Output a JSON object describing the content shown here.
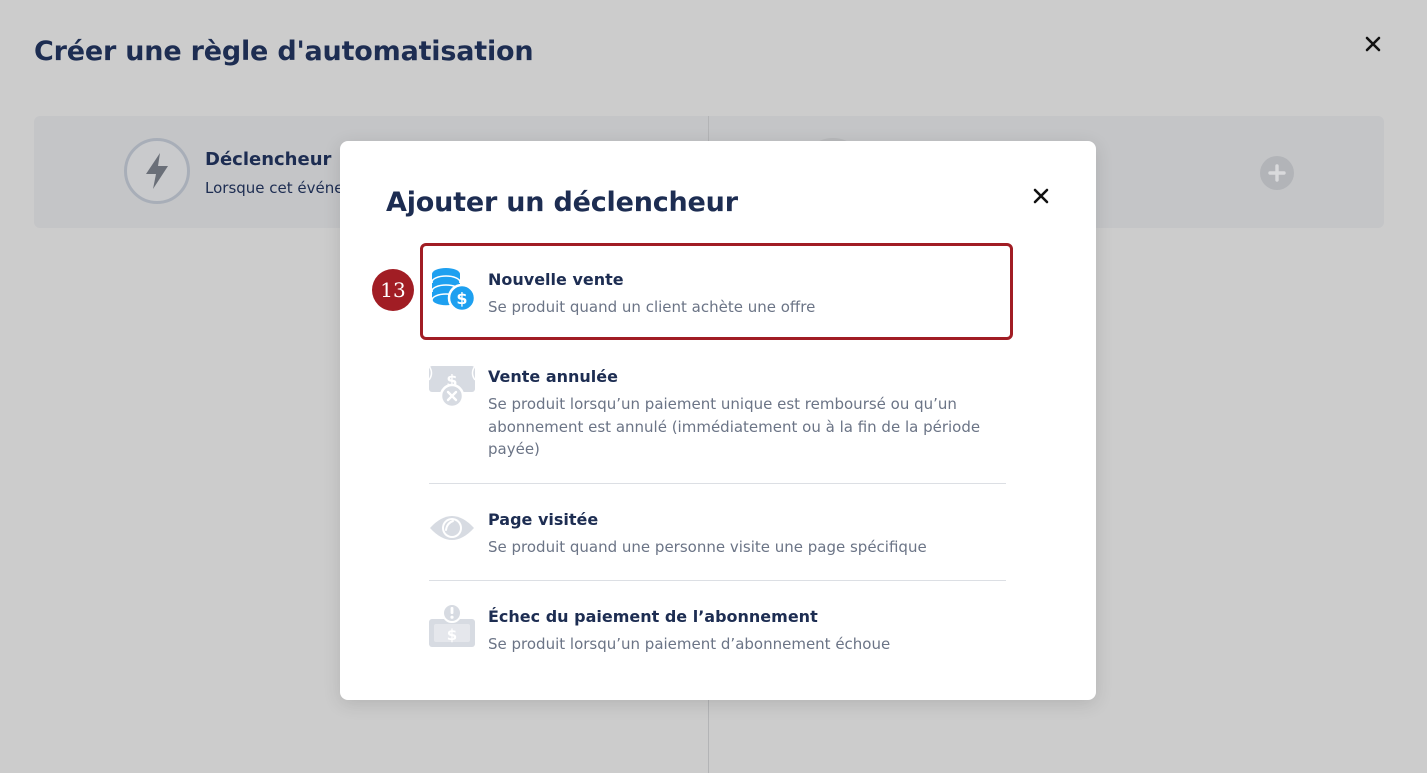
{
  "page": {
    "title": "Créer une règle d'automatisation",
    "close_icon": "close-icon"
  },
  "flow": {
    "trigger": {
      "icon": "lightning-icon",
      "title": "Déclencheur",
      "subtitle": "Lorsque cet événer"
    },
    "add_icon": "plus-circle-icon"
  },
  "modal": {
    "title": "Ajouter un déclencheur",
    "close_icon": "close-icon",
    "options": [
      {
        "icon": "coins-dollar-icon",
        "title": "Nouvelle vente",
        "description": "Se produit quand un client achète une offre"
      },
      {
        "icon": "cancelled-payment-icon",
        "title": "Vente annulée",
        "description": "Se produit lorsqu’un paiement unique est remboursé ou qu’un abonnement est annulé (immédiatement ou à la fin de la période payée)"
      },
      {
        "icon": "eye-icon",
        "title": "Page visitée",
        "description": "Se produit quand une personne visite une page spécifique"
      },
      {
        "icon": "payment-failed-icon",
        "title": "Échec du paiement de l’abonnement",
        "description": "Se produit lorsqu’un paiement d’abonnement échoue"
      }
    ]
  },
  "annotation": {
    "step_number": "13",
    "color": "#a11d24"
  },
  "colors": {
    "primary_text": "#1d2d52",
    "secondary_text": "#6b7486",
    "accent_blue": "#1ea0f0",
    "overlay_background": "#cccccc"
  }
}
